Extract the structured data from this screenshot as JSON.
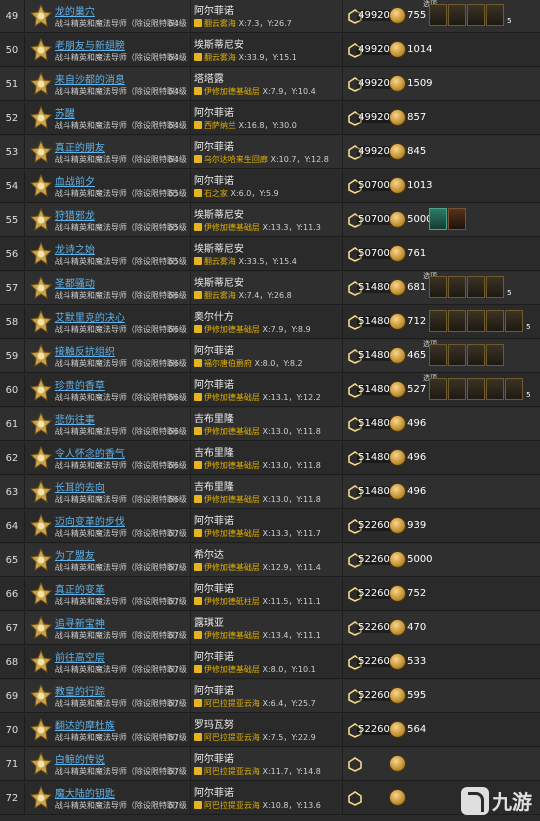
{
  "quest_subtitle": "战斗精英和魔法导师（除设限特职）",
  "option_label": "选项",
  "rows": [
    {
      "num": "49",
      "name": "龙的巢穴",
      "level": "54级",
      "npc": "阿尔菲诺",
      "loc": "翻云雾海",
      "coord": "X:7.3，Y:26.7",
      "exp": "49920",
      "gil": "755",
      "items": 4,
      "optional": true,
      "count": "5"
    },
    {
      "num": "50",
      "name": "老朋友与新翅膀",
      "level": "54级",
      "npc": "埃斯蒂尼安",
      "loc": "翻云雾海",
      "coord": "X:33.9，Y:15.1",
      "exp": "49920",
      "gil": "1014",
      "items": 0
    },
    {
      "num": "51",
      "name": "来自沙都的消息",
      "level": "54级",
      "npc": "塔塔露",
      "loc": "伊修加德基础层",
      "coord": "X:7.9，Y:10.4",
      "exp": "49920",
      "gil": "1509",
      "items": 0
    },
    {
      "num": "52",
      "name": "苏醒",
      "level": "54级",
      "npc": "阿尔菲诺",
      "loc": "西萨纳兰",
      "coord": "X:16.8，Y:30.0",
      "exp": "49920",
      "gil": "857",
      "items": 0
    },
    {
      "num": "53",
      "name": "真正的朋友",
      "level": "54级",
      "npc": "阿尔菲诺",
      "loc": "乌尔达哈来生回廊",
      "coord": "X:10.7，Y:12.8",
      "exp": "49920",
      "gil": "845",
      "items": 0
    },
    {
      "num": "54",
      "name": "血战前夕",
      "level": "55级",
      "npc": "阿尔菲诺",
      "loc": "石之家",
      "coord": "X:6.0，Y:5.9",
      "exp": "50700",
      "gil": "1013",
      "items": 0
    },
    {
      "num": "55",
      "name": "狩猎邪龙",
      "level": "55级",
      "npc": "埃斯蒂尼安",
      "loc": "伊修加德基础层",
      "coord": "X:13.3，Y:11.3",
      "exp": "50700",
      "gil": "5000",
      "items": 2,
      "special": true
    },
    {
      "num": "56",
      "name": "龙诗之始",
      "level": "55级",
      "npc": "埃斯蒂尼安",
      "loc": "翻云雾海",
      "coord": "X:33.5，Y:15.4",
      "exp": "50700",
      "gil": "761",
      "items": 0
    },
    {
      "num": "57",
      "name": "圣都骚动",
      "level": "56级",
      "npc": "埃斯蒂尼安",
      "loc": "翻云雾海",
      "coord": "X:7.4，Y:26.8",
      "exp": "51480",
      "gil": "681",
      "items": 4,
      "optional": true,
      "count": "5"
    },
    {
      "num": "58",
      "name": "艾默里克的决心",
      "level": "56级",
      "npc": "奥尔什方",
      "loc": "伊修加德基础层",
      "coord": "X:7.9，Y:8.9",
      "exp": "51480",
      "gil": "712",
      "items": 5,
      "count": "5"
    },
    {
      "num": "59",
      "name": "接触反抗组织",
      "level": "56级",
      "npc": "阿尔菲诺",
      "loc": "福尔唐伯爵府",
      "coord": "X:8.0，Y:8.2",
      "exp": "51480",
      "gil": "465",
      "items": 4,
      "optional": true
    },
    {
      "num": "60",
      "name": "珍贵的香草",
      "level": "56级",
      "npc": "阿尔菲诺",
      "loc": "伊修加德基础层",
      "coord": "X:13.1，Y:12.2",
      "exp": "51480",
      "gil": "527",
      "items": 5,
      "optional": true,
      "count": "5"
    },
    {
      "num": "61",
      "name": "悲伤往事",
      "level": "56级",
      "npc": "吉布里隆",
      "loc": "伊修加德基础层",
      "coord": "X:13.0，Y:11.8",
      "exp": "51480",
      "gil": "496",
      "items": 0
    },
    {
      "num": "62",
      "name": "令人怀念的香气",
      "level": "56级",
      "npc": "吉布里隆",
      "loc": "伊修加德基础层",
      "coord": "X:13.0，Y:11.8",
      "exp": "51480",
      "gil": "496",
      "items": 0
    },
    {
      "num": "63",
      "name": "长耳的去向",
      "level": "56级",
      "npc": "吉布里隆",
      "loc": "伊修加德基础层",
      "coord": "X:13.0，Y:11.8",
      "exp": "51480",
      "gil": "496",
      "items": 0
    },
    {
      "num": "64",
      "name": "迈向变革的步伐",
      "level": "57级",
      "npc": "阿尔菲诺",
      "loc": "伊修加德基础层",
      "coord": "X:13.3，Y:11.7",
      "exp": "52260",
      "gil": "939",
      "items": 0
    },
    {
      "num": "65",
      "name": "为了盟友",
      "level": "57级",
      "npc": "希尔达",
      "loc": "伊修加德基础层",
      "coord": "X:12.9，Y:11.4",
      "exp": "52260",
      "gil": "5000",
      "items": 0
    },
    {
      "num": "66",
      "name": "真正的变革",
      "level": "57级",
      "npc": "阿尔菲诺",
      "loc": "伊修加德砥柱层",
      "coord": "X:11.5，Y:11.1",
      "exp": "52260",
      "gil": "752",
      "items": 0
    },
    {
      "num": "67",
      "name": "追寻新宝神",
      "level": "57级",
      "npc": "露琪亚",
      "loc": "伊修加德基础层",
      "coord": "X:13.4，Y:11.1",
      "exp": "52260",
      "gil": "470",
      "items": 0
    },
    {
      "num": "68",
      "name": "前往高空层",
      "level": "57级",
      "npc": "阿尔菲诺",
      "loc": "伊修加德基础层",
      "coord": "X:8.0，Y:10.1",
      "exp": "52260",
      "gil": "533",
      "items": 0
    },
    {
      "num": "69",
      "name": "教皇的行踪",
      "level": "57级",
      "npc": "阿尔菲诺",
      "loc": "阿巴拉提亚云海",
      "coord": "X:6.4，Y:25.7",
      "exp": "52260",
      "gil": "595",
      "items": 0
    },
    {
      "num": "70",
      "name": "翻达的摩杜族",
      "level": "57级",
      "npc": "罗玛瓦努",
      "loc": "阿巴拉提亚云海",
      "coord": "X:7.5，Y:22.9",
      "exp": "52260",
      "gil": "564",
      "items": 0
    },
    {
      "num": "71",
      "name": "白鲸的传说",
      "level": "57级",
      "npc": "阿尔菲诺",
      "loc": "阿巴拉提亚云海",
      "coord": "X:11.7，Y:14.8",
      "exp": "",
      "gil": "",
      "items": 0
    },
    {
      "num": "72",
      "name": "魔大陆的钥匙",
      "level": "57级",
      "npc": "阿尔菲诺",
      "loc": "阿巴拉提亚云海",
      "coord": "X:10.8，Y:13.6",
      "exp": "",
      "gil": "",
      "items": 0
    }
  ],
  "watermark": {
    "text": "九游"
  }
}
